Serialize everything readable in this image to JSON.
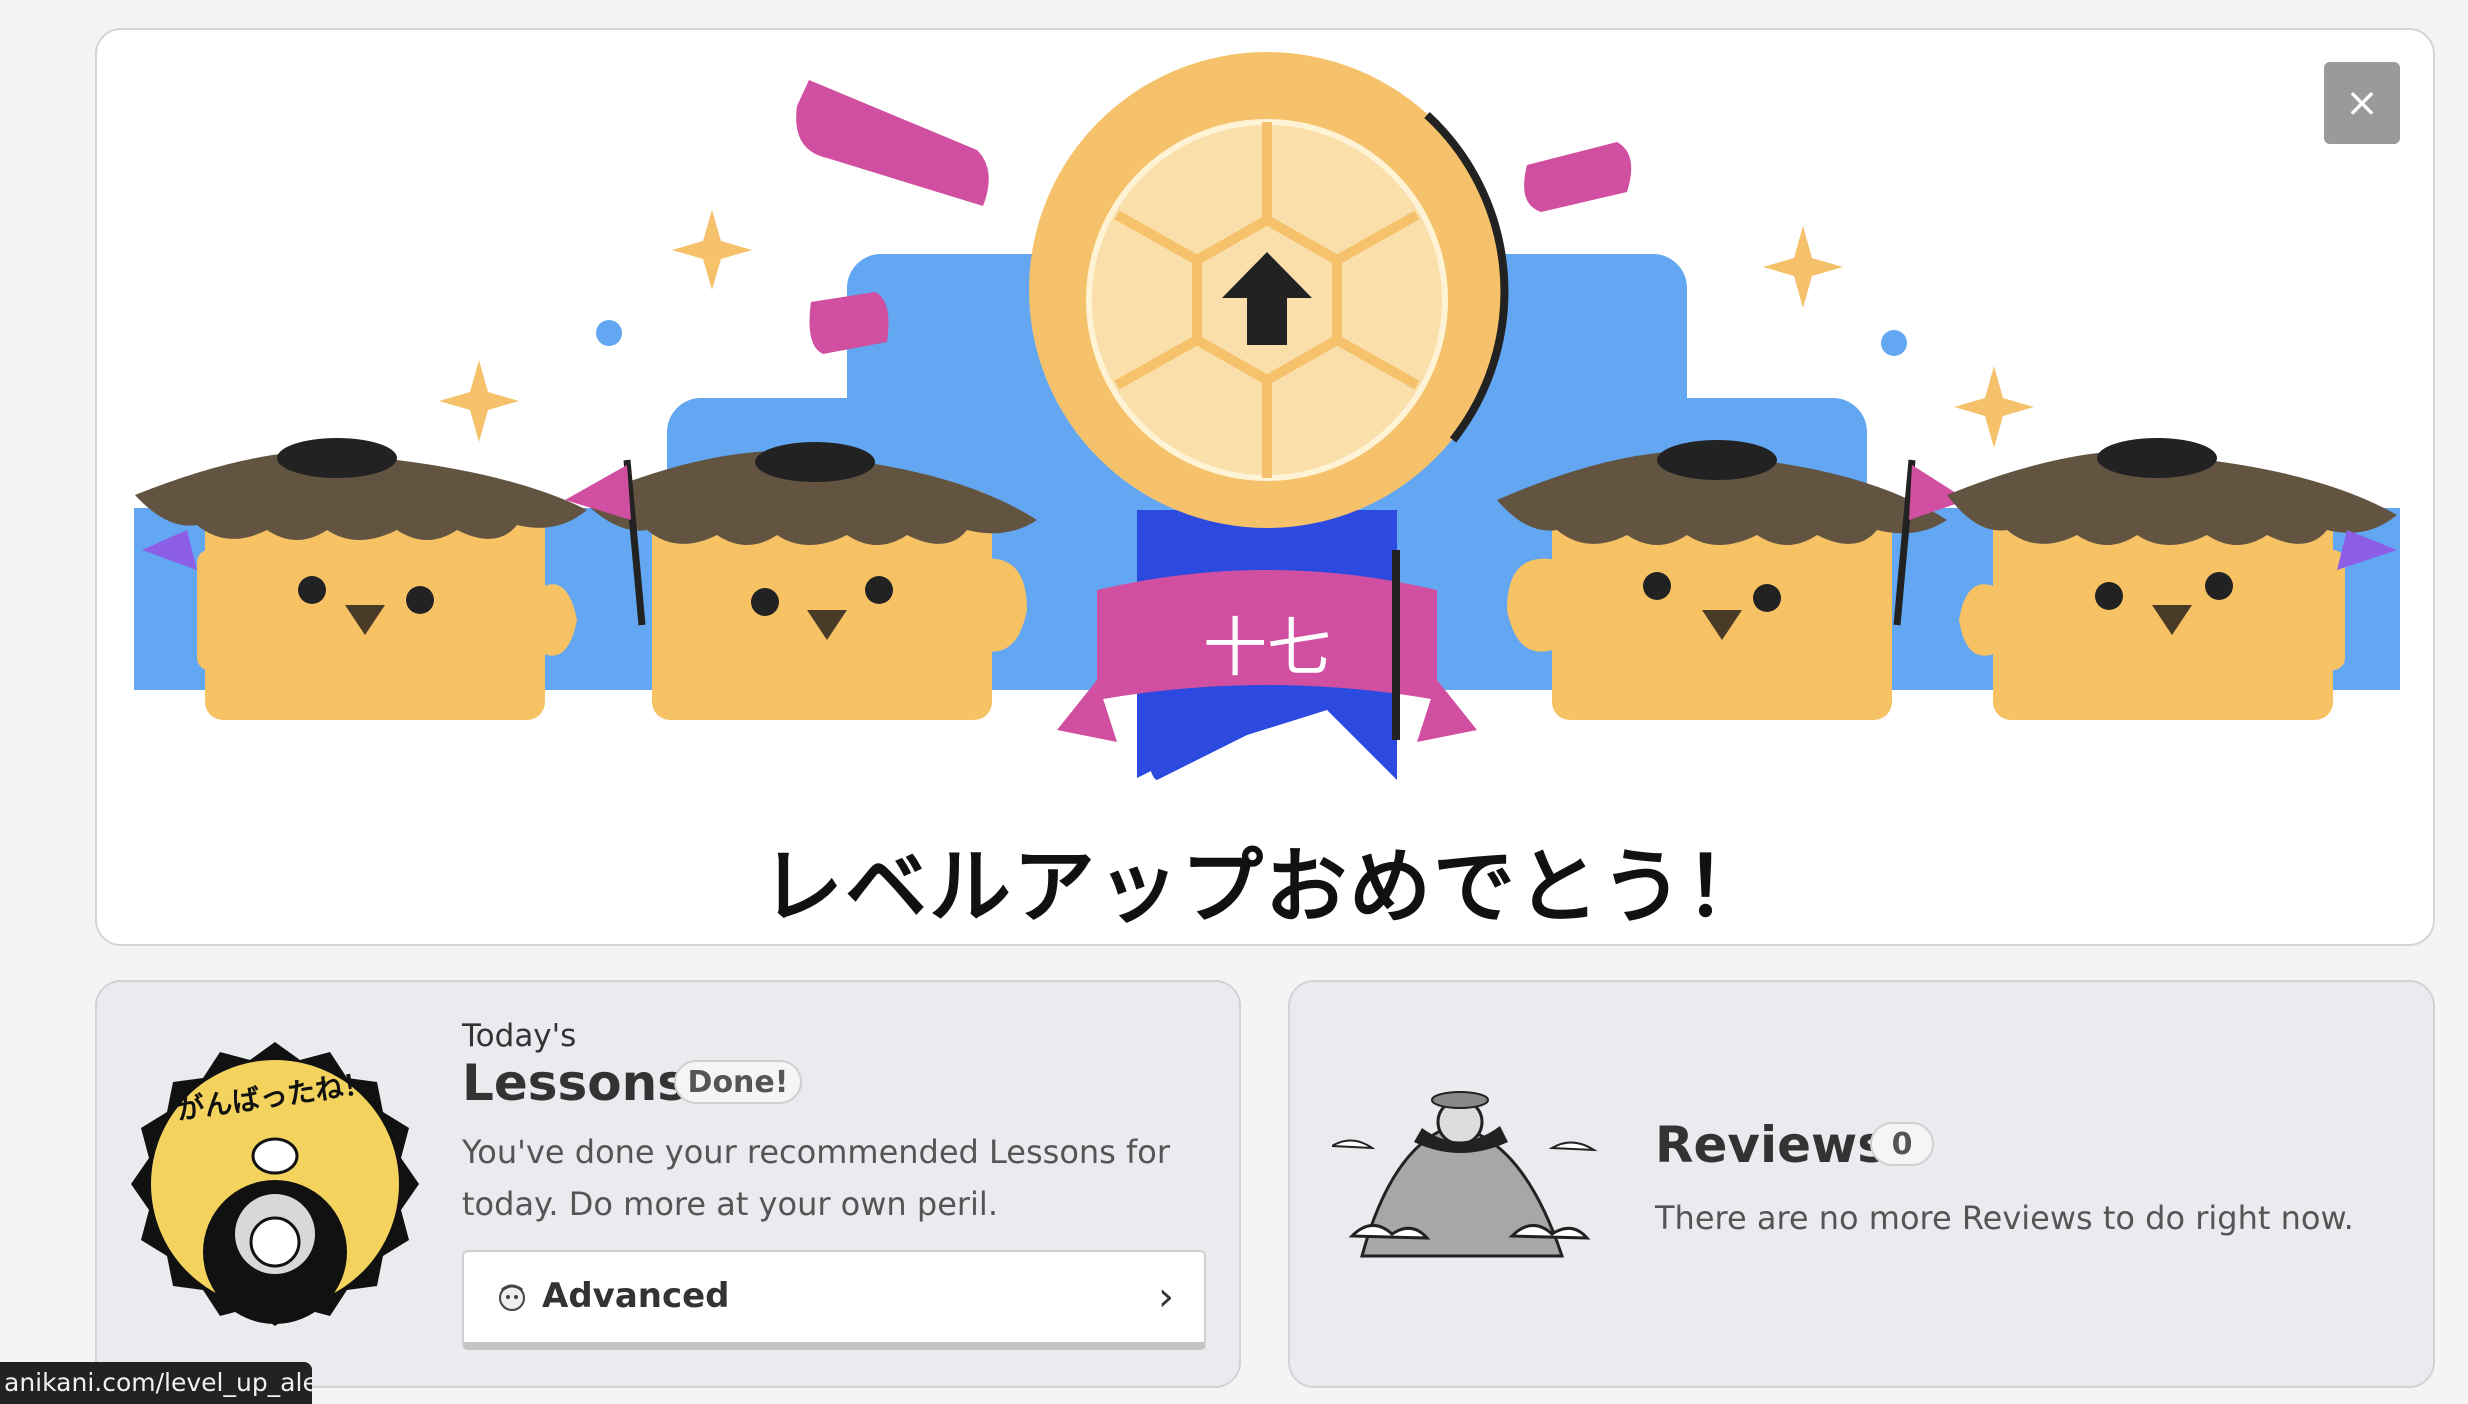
{
  "levelup": {
    "title": "レベルアップおめでとう！",
    "level_kanji": "十七",
    "close_label": "×"
  },
  "lessons": {
    "eyebrow": "Today's",
    "title": "Lessons",
    "badge": "Done!",
    "sticker_text": "がんばったね！",
    "description": "You've done your recommended Lessons for today. Do more at your own peril.",
    "button_label": "Advanced",
    "chevron": "›"
  },
  "reviews": {
    "title": "Reviews",
    "count": "0",
    "description": "There are no more Reviews to do right now."
  },
  "status_bar": {
    "url": "anikani.com/level_up_alert"
  },
  "colors": {
    "coin": "#f5c26b",
    "coin_inner": "#fadfaa",
    "banner_blue": "#63a6f2",
    "ribbon_pink": "#d14fa0",
    "ribbon_blue": "#2c4ae0",
    "bird_body": "#f6c264",
    "bird_hair": "#625441",
    "card_bg": "#e9ebef"
  },
  "icons": [
    "close-icon",
    "level-coin-icon",
    "arrow-up-icon",
    "chevron-right-icon",
    "advanced-crabigator-icon"
  ]
}
